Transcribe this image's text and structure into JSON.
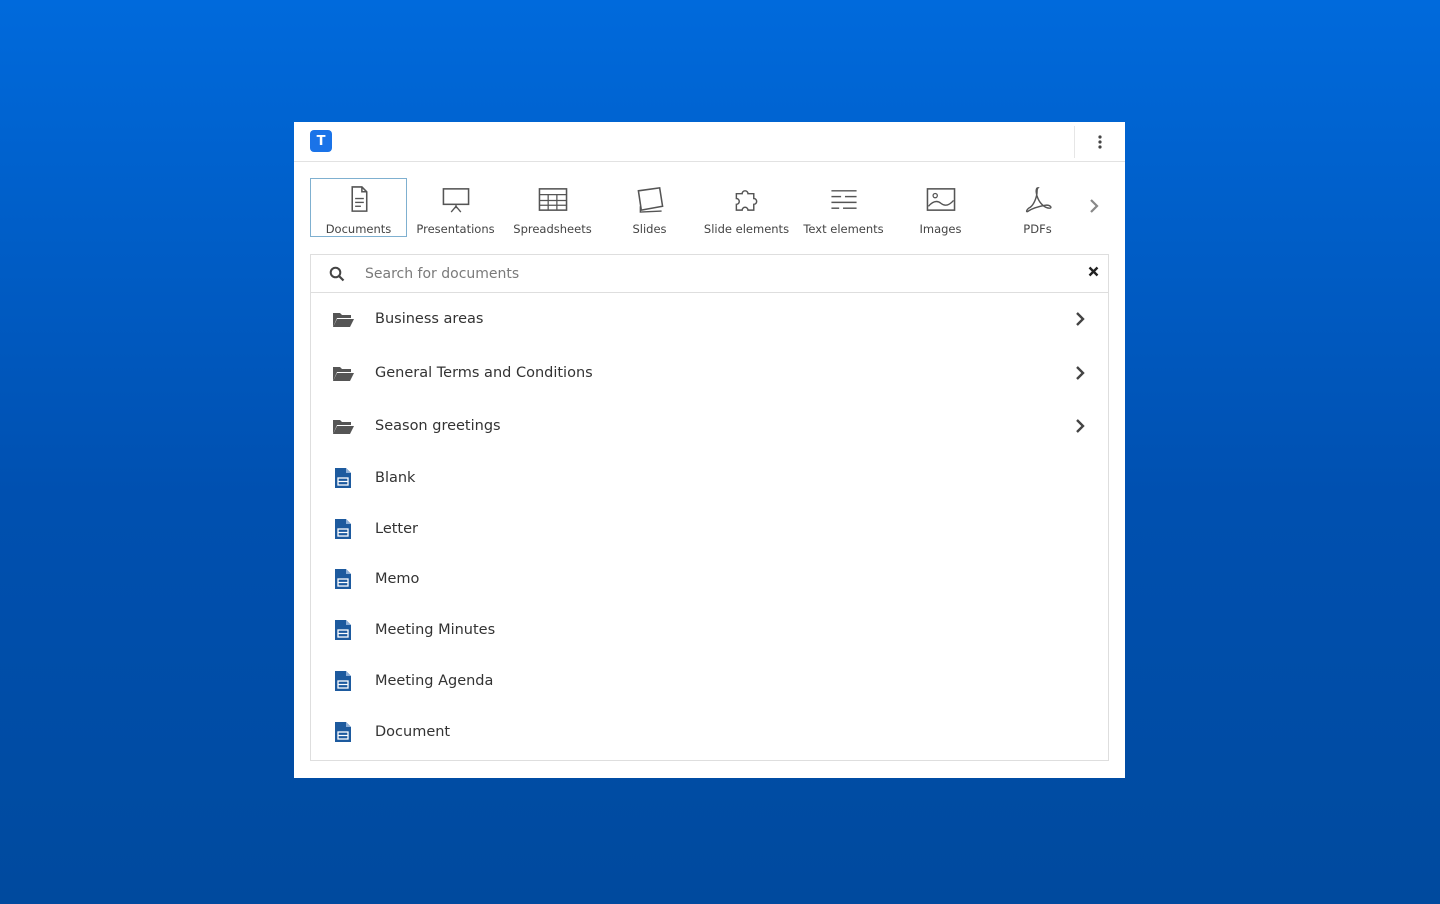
{
  "app": {
    "logo_letter": "T",
    "brand_color": "#1a73e8"
  },
  "categories": [
    {
      "label": "Documents",
      "icon": "document-icon",
      "active": true
    },
    {
      "label": "Presentations",
      "icon": "presentation-icon",
      "active": false
    },
    {
      "label": "Spreadsheets",
      "icon": "spreadsheet-icon",
      "active": false
    },
    {
      "label": "Slides",
      "icon": "slides-icon",
      "active": false
    },
    {
      "label": "Slide elements",
      "icon": "puzzle-icon",
      "active": false
    },
    {
      "label": "Text elements",
      "icon": "text-lines-icon",
      "active": false
    },
    {
      "label": "Images",
      "icon": "image-icon",
      "active": false
    },
    {
      "label": "PDFs",
      "icon": "pdf-icon",
      "active": false
    }
  ],
  "search": {
    "placeholder": "Search for documents",
    "value": ""
  },
  "folders": [
    {
      "label": "Business areas"
    },
    {
      "label": "General Terms and Conditions"
    },
    {
      "label": "Season greetings"
    }
  ],
  "documents": [
    {
      "label": "Blank"
    },
    {
      "label": "Letter"
    },
    {
      "label": "Memo"
    },
    {
      "label": "Meeting Minutes"
    },
    {
      "label": "Meeting Agenda"
    },
    {
      "label": "Document"
    }
  ],
  "colors": {
    "doc_icon": "#1d5a9e",
    "folder_icon": "#555555",
    "active_border": "#7fb0d0"
  }
}
